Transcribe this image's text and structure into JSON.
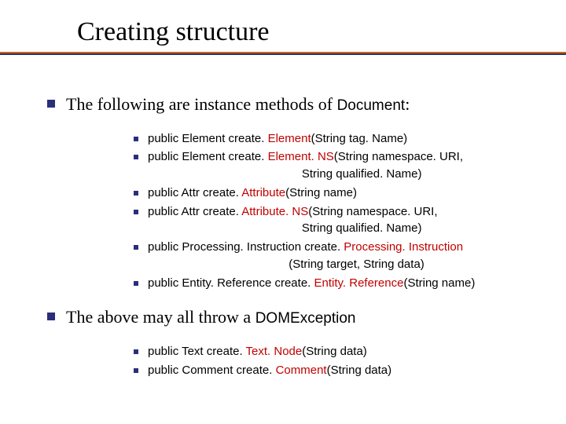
{
  "title": "Creating structure",
  "point1": {
    "prefix": "The following are instance methods of ",
    "code": "Document",
    "suffix": ":"
  },
  "methods1": [
    {
      "pre": "public Element create. ",
      "hl": "Element",
      "post": "(String tag. Name)"
    },
    {
      "pre": "public Element create. ",
      "hl": "Element. NS",
      "post": "(String namespace. URI,",
      "cont": "                                               String qualified. Name)"
    },
    {
      "pre": "public Attr create. ",
      "hl": "Attribute",
      "post": "(String name)"
    },
    {
      "pre": "public Attr create. ",
      "hl": "Attribute. NS",
      "post": "(String namespace. URI,",
      "cont": "                                               String qualified. Name)"
    },
    {
      "pre": "public Processing. Instruction create. ",
      "hl": "Processing. Instruction",
      "post": "",
      "cont": "                                           (String target, String data)"
    },
    {
      "pre": "public Entity. Reference create. ",
      "hl": "Entity. Reference",
      "post": "(String name)"
    }
  ],
  "point2": {
    "prefix": "The above may all throw a ",
    "code": "DOMException"
  },
  "methods2": [
    {
      "pre": "public Text create. ",
      "hl": "Text. Node",
      "post": "(String data)"
    },
    {
      "pre": "public Comment create. ",
      "hl": "Comment",
      "post": "(String data)"
    }
  ]
}
